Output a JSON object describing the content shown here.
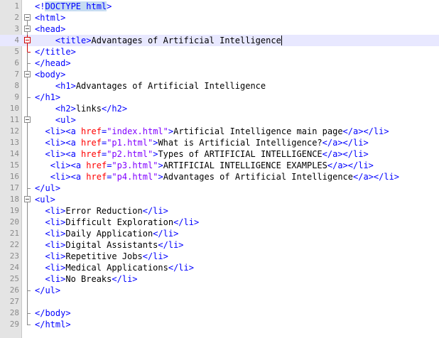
{
  "line_numbers": [
    "1",
    "2",
    "3",
    "4",
    "5",
    "6",
    "7",
    "8",
    "9",
    "10",
    "11",
    "12",
    "13",
    "14",
    "15",
    "16",
    "17",
    "18",
    "19",
    "20",
    "21",
    "22",
    "23",
    "24",
    "25",
    "26",
    "27",
    "28",
    "29"
  ],
  "code_lines": [
    {
      "pre": "",
      "segments": [
        {
          "t": "<!",
          "c": "tag"
        },
        {
          "t": "DOCTYPE html",
          "c": "doctype"
        },
        {
          "t": ">",
          "c": "tag"
        }
      ]
    },
    {
      "pre": "",
      "segments": [
        {
          "t": "<html>",
          "c": "tag"
        }
      ]
    },
    {
      "pre": "",
      "segments": [
        {
          "t": "<head>",
          "c": "tag"
        }
      ]
    },
    {
      "pre": "    ",
      "segments": [
        {
          "t": "<title>",
          "c": "tag"
        },
        {
          "t": "Advantages of Artificial Intelligence",
          "c": "text"
        }
      ],
      "caret": true
    },
    {
      "pre": "",
      "segments": [
        {
          "t": "</title>",
          "c": "tag"
        }
      ]
    },
    {
      "pre": "",
      "segments": [
        {
          "t": "</head>",
          "c": "tag"
        }
      ]
    },
    {
      "pre": "",
      "segments": [
        {
          "t": "<body>",
          "c": "tag"
        }
      ]
    },
    {
      "pre": "    ",
      "segments": [
        {
          "t": "<h1>",
          "c": "tag"
        },
        {
          "t": "Advantages of Artificial Intelligence",
          "c": "text"
        }
      ]
    },
    {
      "pre": "",
      "segments": [
        {
          "t": "</h1>",
          "c": "tag"
        }
      ]
    },
    {
      "pre": "    ",
      "segments": [
        {
          "t": "<h2>",
          "c": "tag"
        },
        {
          "t": "links",
          "c": "text"
        },
        {
          "t": "</h2>",
          "c": "tag"
        }
      ]
    },
    {
      "pre": "    ",
      "segments": [
        {
          "t": "<ul>",
          "c": "tag"
        }
      ]
    },
    {
      "pre": "  ",
      "segments": [
        {
          "t": "<li>",
          "c": "tag"
        },
        {
          "t": "<a ",
          "c": "tag"
        },
        {
          "t": "href",
          "c": "attr"
        },
        {
          "t": "=",
          "c": "tag"
        },
        {
          "t": "\"index.html\"",
          "c": "str"
        },
        {
          "t": ">",
          "c": "tag"
        },
        {
          "t": "Artificial Intelligence main page",
          "c": "text"
        },
        {
          "t": "</a>",
          "c": "tag"
        },
        {
          "t": "</li>",
          "c": "tag"
        }
      ]
    },
    {
      "pre": "  ",
      "segments": [
        {
          "t": "<li>",
          "c": "tag"
        },
        {
          "t": "<a ",
          "c": "tag"
        },
        {
          "t": "href",
          "c": "attr"
        },
        {
          "t": "=",
          "c": "tag"
        },
        {
          "t": "\"p1.html\"",
          "c": "str"
        },
        {
          "t": ">",
          "c": "tag"
        },
        {
          "t": "What is Artificial Intelligence?",
          "c": "text"
        },
        {
          "t": "</a>",
          "c": "tag"
        },
        {
          "t": "</li>",
          "c": "tag"
        }
      ]
    },
    {
      "pre": "  ",
      "segments": [
        {
          "t": "<li>",
          "c": "tag"
        },
        {
          "t": "<a ",
          "c": "tag"
        },
        {
          "t": "href",
          "c": "attr"
        },
        {
          "t": "=",
          "c": "tag"
        },
        {
          "t": "\"p2.html\"",
          "c": "str"
        },
        {
          "t": ">",
          "c": "tag"
        },
        {
          "t": "Types of ARTIFICIAL INTELLIGENCE",
          "c": "text"
        },
        {
          "t": "</a>",
          "c": "tag"
        },
        {
          "t": "</li>",
          "c": "tag"
        }
      ]
    },
    {
      "pre": "   ",
      "segments": [
        {
          "t": "<li>",
          "c": "tag"
        },
        {
          "t": "<a ",
          "c": "tag"
        },
        {
          "t": "href",
          "c": "attr"
        },
        {
          "t": "=",
          "c": "tag"
        },
        {
          "t": "\"p3.html\"",
          "c": "str"
        },
        {
          "t": ">",
          "c": "tag"
        },
        {
          "t": "ARTIFICIAL INTELLIGENCE EXAMPLES",
          "c": "text"
        },
        {
          "t": "</a>",
          "c": "tag"
        },
        {
          "t": "</li>",
          "c": "tag"
        }
      ]
    },
    {
      "pre": "   ",
      "segments": [
        {
          "t": "<li>",
          "c": "tag"
        },
        {
          "t": "<a ",
          "c": "tag"
        },
        {
          "t": "href",
          "c": "attr"
        },
        {
          "t": "=",
          "c": "tag"
        },
        {
          "t": "\"p4.html\"",
          "c": "str"
        },
        {
          "t": ">",
          "c": "tag"
        },
        {
          "t": "Advantages of Artificial Intelligence",
          "c": "text"
        },
        {
          "t": "</a>",
          "c": "tag"
        },
        {
          "t": "</li>",
          "c": "tag"
        }
      ]
    },
    {
      "pre": "",
      "segments": [
        {
          "t": "</ul>",
          "c": "tag"
        }
      ]
    },
    {
      "pre": "",
      "segments": [
        {
          "t": "<ul>",
          "c": "tag"
        }
      ]
    },
    {
      "pre": "  ",
      "segments": [
        {
          "t": "<li>",
          "c": "tag"
        },
        {
          "t": "Error Reduction",
          "c": "text"
        },
        {
          "t": "</li>",
          "c": "tag"
        }
      ]
    },
    {
      "pre": "  ",
      "segments": [
        {
          "t": "<li>",
          "c": "tag"
        },
        {
          "t": "Difficult Exploration",
          "c": "text"
        },
        {
          "t": "</li>",
          "c": "tag"
        }
      ]
    },
    {
      "pre": "  ",
      "segments": [
        {
          "t": "<li>",
          "c": "tag"
        },
        {
          "t": "Daily Application",
          "c": "text"
        },
        {
          "t": "</li>",
          "c": "tag"
        }
      ]
    },
    {
      "pre": "  ",
      "segments": [
        {
          "t": "<li>",
          "c": "tag"
        },
        {
          "t": "Digital Assistants",
          "c": "text"
        },
        {
          "t": "</li>",
          "c": "tag"
        }
      ]
    },
    {
      "pre": "  ",
      "segments": [
        {
          "t": "<li>",
          "c": "tag"
        },
        {
          "t": "Repetitive Jobs",
          "c": "text"
        },
        {
          "t": "</li>",
          "c": "tag"
        }
      ]
    },
    {
      "pre": "  ",
      "segments": [
        {
          "t": "<li>",
          "c": "tag"
        },
        {
          "t": "Medical Applications",
          "c": "text"
        },
        {
          "t": "</li>",
          "c": "tag"
        }
      ]
    },
    {
      "pre": "  ",
      "segments": [
        {
          "t": "<li>",
          "c": "tag"
        },
        {
          "t": "No Breaks",
          "c": "text"
        },
        {
          "t": "</li>",
          "c": "tag"
        }
      ]
    },
    {
      "pre": "",
      "segments": [
        {
          "t": "</ul>",
          "c": "tag"
        }
      ]
    },
    {
      "pre": "",
      "segments": []
    },
    {
      "pre": "",
      "segments": [
        {
          "t": "</body>",
          "c": "tag"
        }
      ]
    },
    {
      "pre": "",
      "segments": [
        {
          "t": "</html>",
          "c": "tag"
        }
      ]
    }
  ],
  "fold_markers": [
    "none",
    "box",
    "box",
    "box-red",
    "end-red",
    "end",
    "box",
    "line",
    "end",
    "line",
    "box",
    "line",
    "line",
    "line",
    "line",
    "line",
    "end",
    "box",
    "line",
    "line",
    "line",
    "line",
    "line",
    "line",
    "line",
    "end",
    "line",
    "end",
    "end"
  ],
  "colors": {
    "tag": "#0000ff",
    "attribute": "#ff0000",
    "string": "#8000ff",
    "current_line": "#e8e8ff"
  }
}
